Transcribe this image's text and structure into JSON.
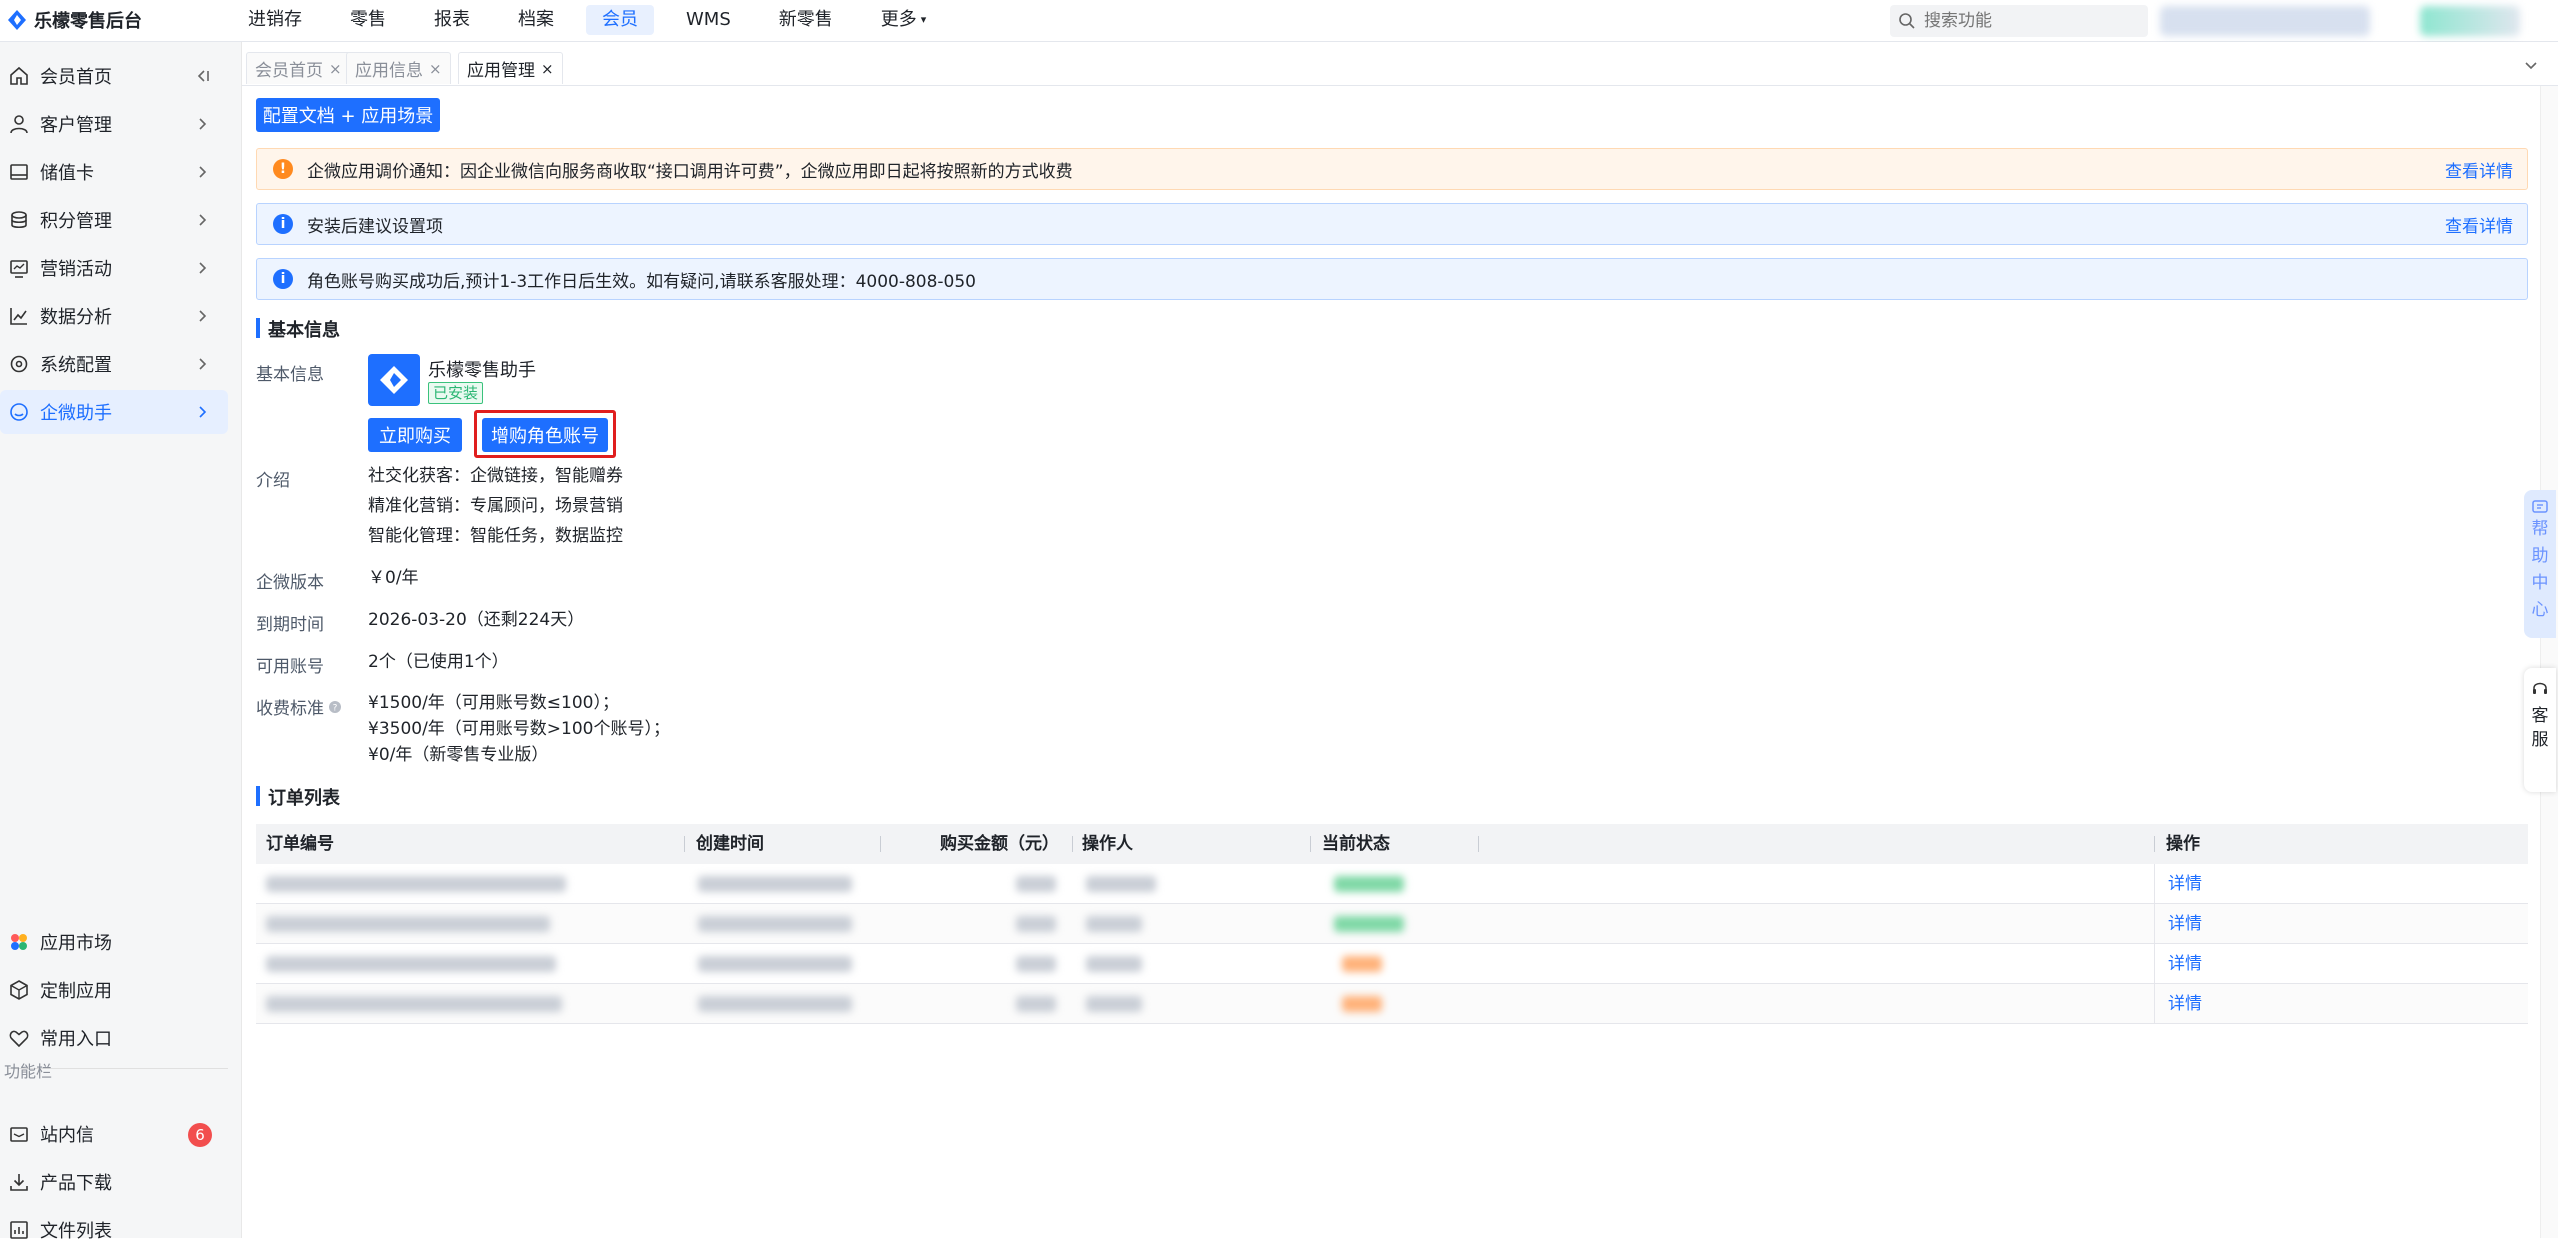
{
  "brand": {
    "title": "乐檬零售后台"
  },
  "topnav": [
    {
      "label": "进销存",
      "active": false
    },
    {
      "label": "零售",
      "active": false
    },
    {
      "label": "报表",
      "active": false
    },
    {
      "label": "档案",
      "active": false
    },
    {
      "label": "会员",
      "active": true
    },
    {
      "label": "WMS",
      "active": false
    },
    {
      "label": "新零售",
      "active": false
    },
    {
      "label": "更多",
      "active": false
    }
  ],
  "search": {
    "placeholder": "搜索功能"
  },
  "sidebar": {
    "items": [
      {
        "label": "会员首页",
        "icon": "home-icon"
      },
      {
        "label": "客户管理",
        "icon": "user-icon"
      },
      {
        "label": "储值卡",
        "icon": "card-icon"
      },
      {
        "label": "积分管理",
        "icon": "coins-icon"
      },
      {
        "label": "营销活动",
        "icon": "marketing-icon"
      },
      {
        "label": "数据分析",
        "icon": "chart-icon"
      },
      {
        "label": "系统配置",
        "icon": "settings-icon"
      },
      {
        "label": "企微助手",
        "icon": "chat-icon",
        "active": true
      }
    ],
    "bottom_items": [
      {
        "label": "应用市场",
        "icon": "app-market-icon"
      },
      {
        "label": "定制应用",
        "icon": "cube-icon"
      },
      {
        "label": "常用入口",
        "icon": "heart-icon"
      }
    ],
    "function_bar_label": "功能栏",
    "function_items": [
      {
        "label": "站内信",
        "icon": "mail-icon",
        "badge": "6"
      },
      {
        "label": "产品下载",
        "icon": "download-icon"
      },
      {
        "label": "文件列表",
        "icon": "file-list-icon"
      }
    ]
  },
  "tabs": [
    {
      "label": "会员首页",
      "close": "×"
    },
    {
      "label": "应用信息",
      "close": "×"
    },
    {
      "label": "应用管理",
      "close": "×",
      "active": true
    }
  ],
  "main": {
    "config_button": "配置文档 + 应用场景",
    "notices": [
      {
        "text": "企微应用调价通知：因企业微信向服务商收取“接口调用许可费”，企微应用即日起将按照新的方式收费",
        "link": "查看详情",
        "type": "warn",
        "mark": "!"
      },
      {
        "text": "安装后建议设置项",
        "link": "查看详情",
        "type": "info",
        "mark": "i"
      },
      {
        "text": "角色账号购买成功后,预计1-3工作日后生效。如有疑问,请联系客服处理：4000-808-050",
        "link": "",
        "type": "info",
        "mark": "i"
      }
    ],
    "basic_info_title": "基本信息",
    "basic_info_label": "基本信息",
    "app_name": "乐檬零售助手",
    "installed_tag": "已安装",
    "buy_button": "立即购买",
    "add_account_button": "增购角色账号",
    "intro_label": "介绍",
    "intro_lines": [
      "社交化获客：企微链接，智能赠券",
      "精准化营销：专属顾问，场景营销",
      "智能化管理：智能任务，数据监控"
    ],
    "edition_label": "企微版本",
    "edition_value": "￥0/年",
    "expire_label": "到期时间",
    "expire_value": "2026-03-20（还剩224天）",
    "accounts_label": "可用账号",
    "accounts_value": "2个（已使用1个）",
    "fee_label": "收费标准",
    "fee_lines": [
      "¥1500/年（可用账号数≤100）；",
      "¥3500/年（可用账号数>100个账号）；",
      "¥0/年（新零售专业版）"
    ],
    "order_list_title": "订单列表",
    "table": {
      "headers": [
        "订单编号",
        "创建时间",
        "购买金额（元）",
        "操作人",
        "当前状态",
        "操作"
      ],
      "rows": [
        {
          "action": "详情",
          "status": "green"
        },
        {
          "action": "详情",
          "status": "green"
        },
        {
          "action": "详情",
          "status": "orange"
        },
        {
          "action": "详情",
          "status": "orange"
        }
      ]
    }
  },
  "right_widgets": {
    "help_center": [
      "帮",
      "助",
      "中",
      "心"
    ],
    "kefu": [
      "客",
      "服"
    ]
  },
  "colors": {
    "primary": "#1e6fff",
    "warn": "#ff8a1f",
    "success": "#2bb673",
    "danger": "#f24e4e"
  }
}
